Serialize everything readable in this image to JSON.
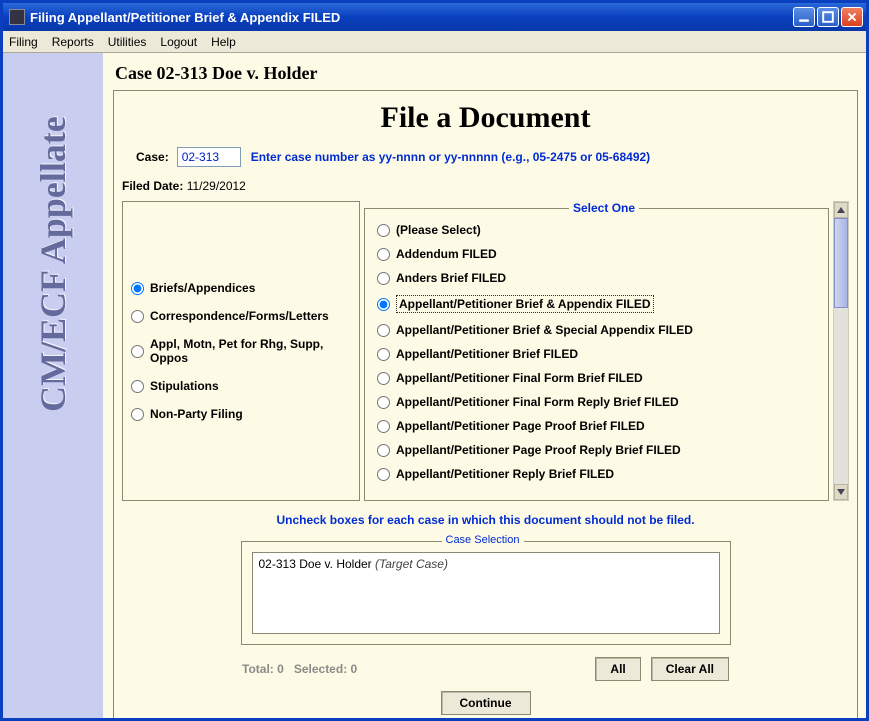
{
  "window": {
    "title": "Filing Appellant/Petitioner Brief & Appendix FILED"
  },
  "menu": [
    "Filing",
    "Reports",
    "Utilities",
    "Logout",
    "Help"
  ],
  "sidebar": {
    "brand": "CM/ECF Appellate"
  },
  "header": {
    "case_title": "Case 02-313 Doe v. Holder",
    "page_heading": "File a Document",
    "case_label": "Case:",
    "case_value": "02-313",
    "case_hint": "Enter case number as yy-nnnn or yy-nnnnn (e.g., 05-2475 or 05-68492)",
    "filed_label": "Filed Date:",
    "filed_value": "11/29/2012"
  },
  "categories": {
    "selected": 0,
    "items": [
      "Briefs/Appendices",
      "Correspondence/Forms/Letters",
      "Appl, Motn, Pet for Rhg, Supp, Oppos",
      "Stipulations",
      "Non-Party Filing"
    ]
  },
  "doc_types": {
    "legend": "Select One",
    "selected": 3,
    "items": [
      "(Please Select)",
      "Addendum FILED",
      "Anders Brief FILED",
      "Appellant/Petitioner Brief & Appendix FILED",
      "Appellant/Petitioner Brief & Special Appendix FILED",
      "Appellant/Petitioner Brief FILED",
      "Appellant/Petitioner Final Form Brief FILED",
      "Appellant/Petitioner Final Form Reply Brief FILED",
      "Appellant/Petitioner Page Proof Brief FILED",
      "Appellant/Petitioner Page Proof Reply Brief FILED",
      "Appellant/Petitioner Reply Brief FILED"
    ]
  },
  "case_selection": {
    "hint": "Uncheck boxes for each case in which this document should not be filed.",
    "legend": "Case Selection",
    "entry_case": "02-313 Doe v. Holder",
    "entry_tag": "(Target Case)",
    "totals_label": "Total:",
    "totals_value": "0",
    "selected_label": "Selected:",
    "selected_value": "0",
    "btn_all": "All",
    "btn_clear": "Clear All"
  },
  "buttons": {
    "continue": "Continue"
  }
}
